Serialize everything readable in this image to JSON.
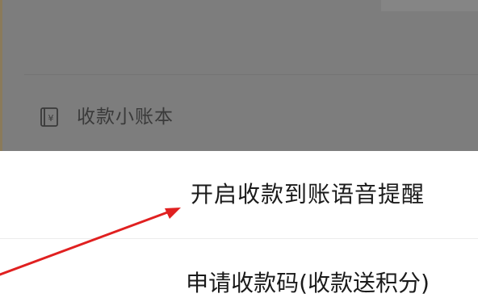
{
  "background_list": {
    "ledger_item": {
      "icon": "ledger-yen-icon",
      "label": "收款小账本"
    }
  },
  "action_sheet": {
    "options": [
      {
        "label": "开启收款到账语音提醒"
      },
      {
        "label": "申请收款码(收款送积分)"
      }
    ]
  },
  "colors": {
    "overlay": "#7d7d7d",
    "sheet_background": "#ffffff",
    "annotation_arrow": "#e02020"
  }
}
